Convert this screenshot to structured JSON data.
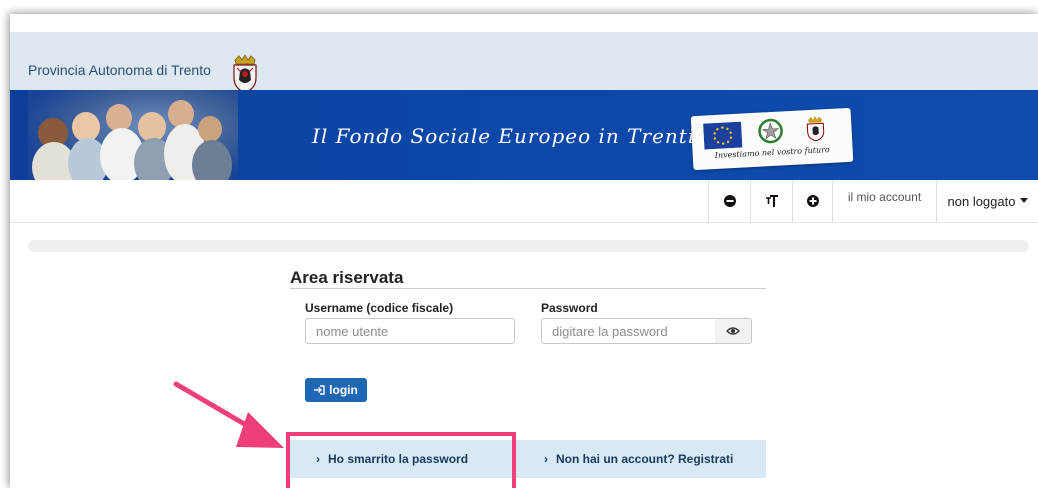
{
  "header": {
    "brand": "Provincia Autonoma di Trento",
    "banner_title": "Il Fondo Sociale Europeo in Trentino",
    "logos_caption": "Investiamo nel vostro futuro"
  },
  "toolbar": {
    "my_account": "il mio account",
    "login_status": "non loggato"
  },
  "login": {
    "title": "Area riservata",
    "username_label": "Username (codice fiscale)",
    "username_placeholder": "nome utente",
    "password_label": "Password",
    "password_placeholder": "digitare la password",
    "login_button": "login"
  },
  "links": {
    "forgot_password": "Ho smarrito la password",
    "register": "Non hai un account? Registrati"
  },
  "colors": {
    "banner_blue": "#0b47a8",
    "top_strip": "#dce7f0",
    "login_button": "#1f66b3",
    "links_bar": "#d6e9f5",
    "highlight": "#ee3f78"
  },
  "icons": [
    "coat-of-arms-icon",
    "decrease-text-icon",
    "text-size-icon",
    "increase-text-icon",
    "caret-down-icon",
    "eye-icon",
    "sign-in-icon",
    "chevron-right-icon",
    "arrow-annotation-icon"
  ]
}
